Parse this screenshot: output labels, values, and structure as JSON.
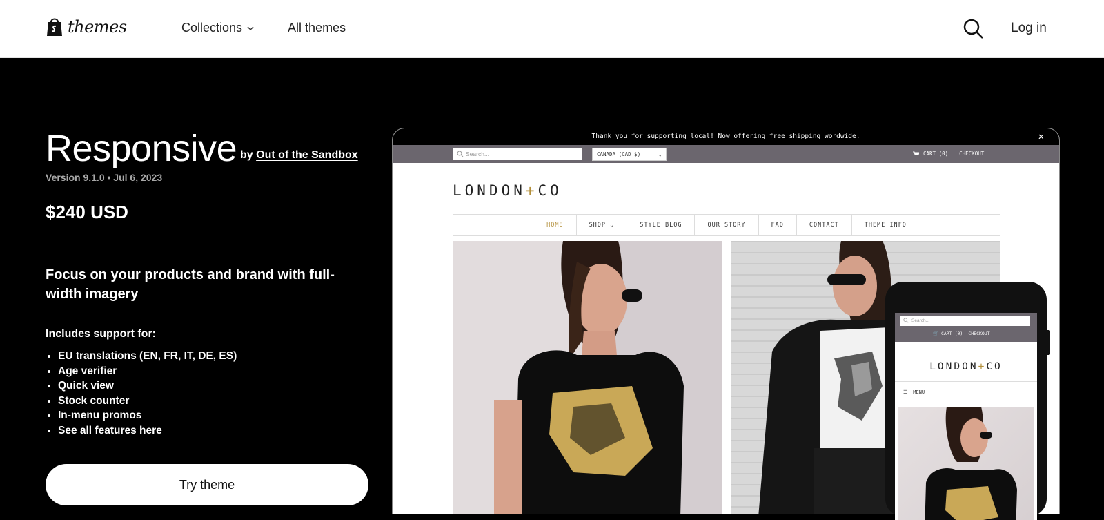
{
  "header": {
    "logo_text": "themes",
    "nav": [
      {
        "label": "Collections"
      },
      {
        "label": "All themes"
      }
    ],
    "login_label": "Log in"
  },
  "theme": {
    "name": "Responsive",
    "by_prefix": "by",
    "author": "Out of the Sandbox",
    "meta": "Version 9.1.0 • Jul 6, 2023",
    "price": "$240 USD",
    "tagline": "Focus on your products and brand with full-width imagery",
    "support_heading": "Includes support for:",
    "features": [
      "EU translations (EN, FR, IT, DE, ES)",
      "Age verifier",
      "Quick view",
      "Stock counter",
      "In-menu promos"
    ],
    "see_all_prefix": "See all features",
    "see_all_link": "here",
    "cta_label": "Try theme"
  },
  "preview": {
    "announcement": "Thank you for supporting local! Now offering free shipping wordwide.",
    "close_glyph": "✕",
    "search_placeholder": "Search...",
    "currency": "CANADA (CAD $)",
    "cart": "CART (0)",
    "checkout": "CHECKOUT",
    "brand_left": "LONDON",
    "brand_plus": "+",
    "brand_right": "CO",
    "nav": [
      "HOME",
      "SHOP",
      "STYLE BLOG",
      "OUR STORY",
      "FAQ",
      "CONTACT",
      "THEME INFO"
    ],
    "mobile_menu": "MENU"
  },
  "colors": {
    "accent_gold": "#b38f3a",
    "utility_bar": "#6b666e"
  }
}
